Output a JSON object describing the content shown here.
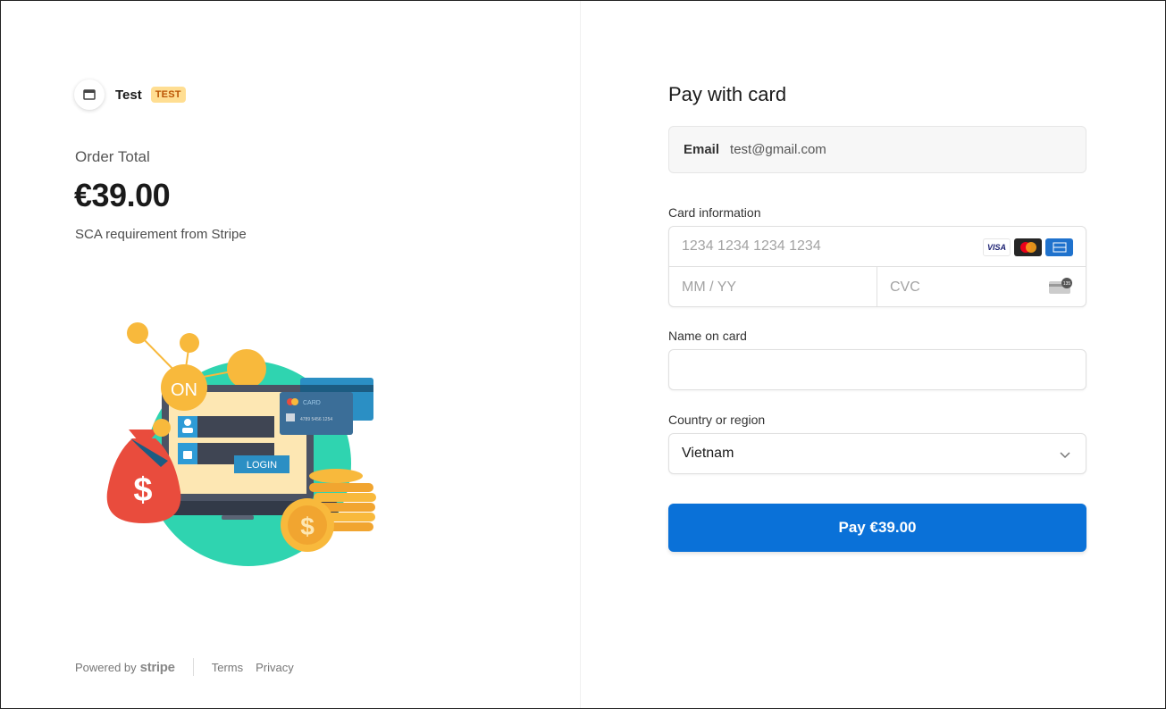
{
  "merchant": {
    "name": "Test",
    "badge": "TEST"
  },
  "order": {
    "label": "Order Total",
    "amount": "€39.00",
    "description": "SCA requirement from Stripe"
  },
  "illustration": {
    "on_label": "ON",
    "login_label": "LOGIN",
    "card_label": "CARD",
    "card_number": "4789 5456 1254",
    "dollar_sign": "$"
  },
  "footer": {
    "powered_by": "Powered by",
    "brand": "stripe",
    "links": [
      "Terms",
      "Privacy"
    ]
  },
  "form": {
    "title": "Pay with card",
    "email": {
      "label": "Email",
      "value": "test@gmail.com"
    },
    "card_info_label": "Card information",
    "card_number_placeholder": "1234 1234 1234 1234",
    "expiry_placeholder": "MM / YY",
    "cvc_placeholder": "CVC",
    "card_brands": [
      "VISA",
      "mastercard",
      "amex"
    ],
    "cvc_badge": "135",
    "name_label": "Name on card",
    "name_value": "",
    "country_label": "Country or region",
    "country_value": "Vietnam",
    "pay_button": "Pay €39.00"
  },
  "colors": {
    "pay_button": "#0a71d8",
    "test_badge_bg": "#ffde92",
    "test_badge_text": "#bb5504"
  }
}
